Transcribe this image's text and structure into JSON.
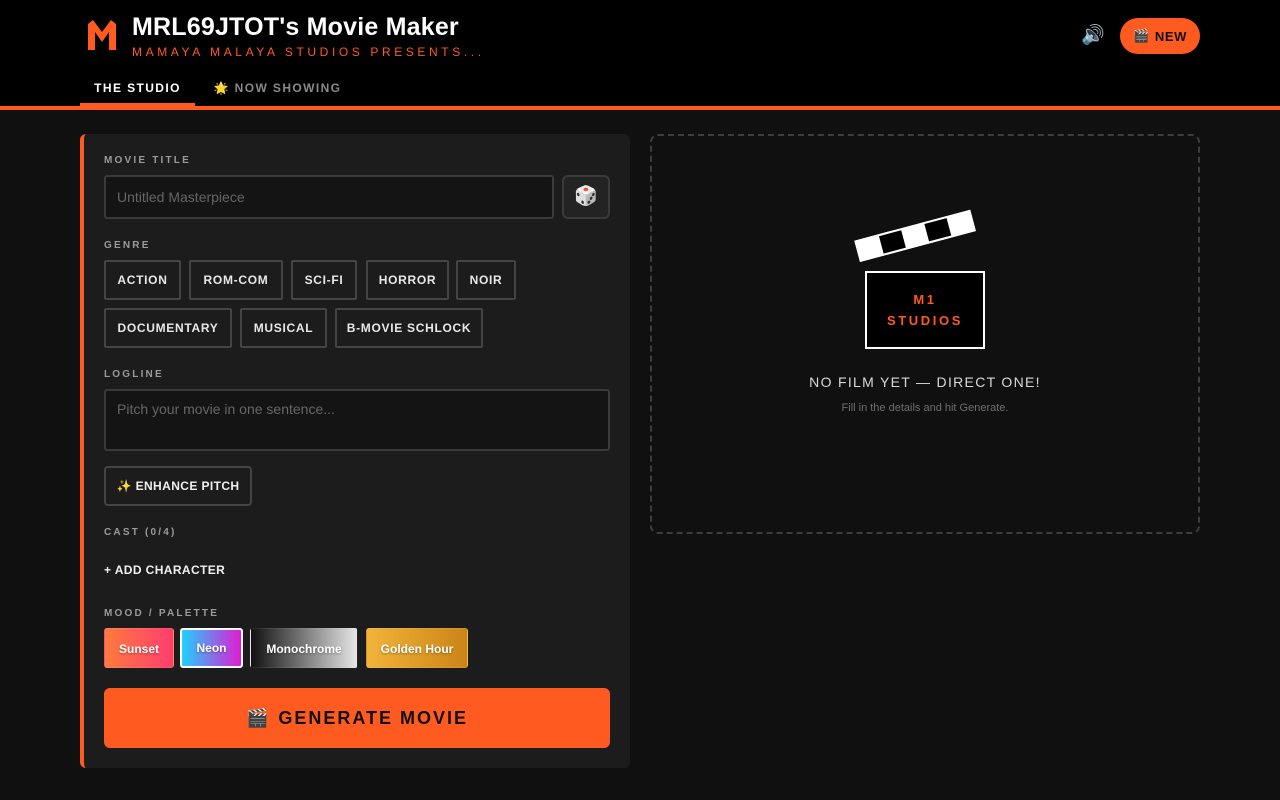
{
  "header": {
    "title": "MRL69JTOT's Movie Maker",
    "subtitle": "MAMAYA MALAYA STUDIOS PRESENTS...",
    "sound_icon": "🔊",
    "new_button": {
      "icon": "🎬",
      "label": "NEW"
    },
    "brand_color": "#ff5a1f"
  },
  "tabs": [
    {
      "label": "THE STUDIO",
      "active": true
    },
    {
      "label": "🌟 NOW SHOWING",
      "active": false
    }
  ],
  "form": {
    "title_label": "MOVIE TITLE",
    "title_value": "",
    "title_placeholder": "Untitled Masterpiece",
    "dice_icon": "🎲",
    "genre_label": "GENRE",
    "genres": [
      "ACTION",
      "ROM-COM",
      "SCI-FI",
      "HORROR",
      "NOIR",
      "DOCUMENTARY",
      "MUSICAL",
      "B-MOVIE SCHLOCK"
    ],
    "logline_label": "LOGLINE",
    "logline_value": "",
    "logline_placeholder": "Pitch your movie in one sentence...",
    "enhance_label": "✨ ENHANCE PITCH",
    "cast_label": "CAST (0/4)",
    "add_character_label": "+ ADD CHARACTER",
    "mood_label": "MOOD / PALETTE",
    "palettes": [
      {
        "name": "Sunset",
        "colors": [
          "#ff7a3d",
          "#ff3d6e"
        ],
        "selected": false
      },
      {
        "name": "Neon",
        "colors": [
          "#1fd1ff",
          "#e21bd3"
        ],
        "selected": true
      },
      {
        "name": "Monochrome",
        "colors": [
          "#111111",
          "#e6e6e6"
        ],
        "selected": false
      },
      {
        "name": "Golden Hour",
        "colors": [
          "#f2b43a",
          "#cc8417"
        ],
        "selected": false
      }
    ],
    "generate": {
      "icon": "🎬",
      "label": "GENERATE MOVIE"
    }
  },
  "preview": {
    "logo_line1": "M1",
    "logo_line2": "STUDIOS",
    "empty_title": "NO FILM YET — DIRECT ONE!",
    "empty_subtitle": "Fill in the details and hit Generate."
  }
}
